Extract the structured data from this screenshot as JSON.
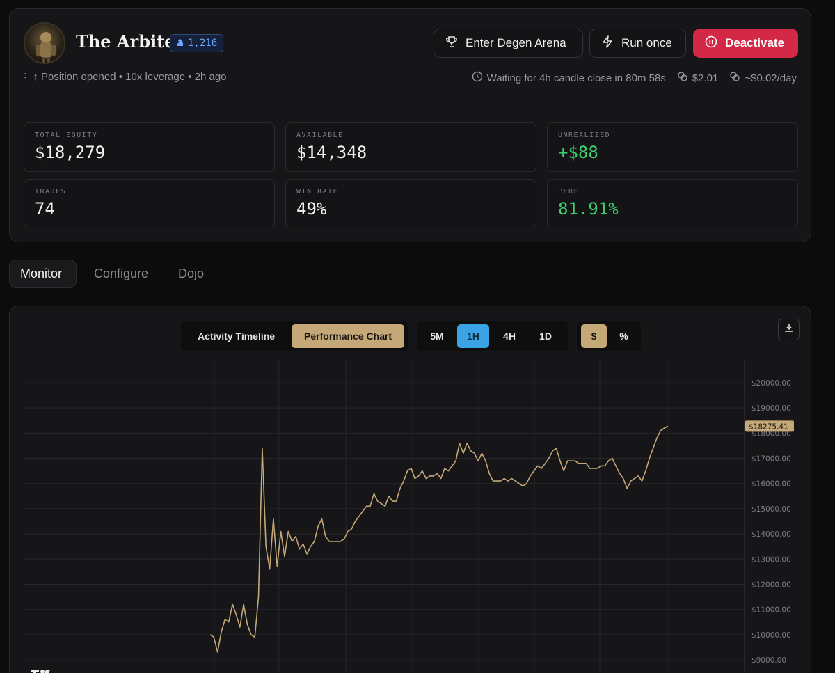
{
  "agent": {
    "name": "The Arbiter",
    "badge_count": "1,216",
    "status": "↑ Position opened • 10x leverage • 2h ago"
  },
  "actions": {
    "arena": "Enter Degen Arena",
    "run": "Run once",
    "deactivate": "Deactivate"
  },
  "meta": {
    "waiting": "Waiting for 4h candle close in 80m 58s",
    "cost": "$2.01",
    "daily": "~$0.02/day"
  },
  "stats": [
    {
      "label": "TOTAL EQUITY",
      "value": "$18,279"
    },
    {
      "label": "AVAILABLE",
      "value": "$14,348"
    },
    {
      "label": "UNREALIZED",
      "value": "+$88"
    },
    {
      "label": "TRADES",
      "value": "74"
    },
    {
      "label": "WIN RATE",
      "value": "49%"
    },
    {
      "label": "PERF",
      "value": "81.91%"
    }
  ],
  "tabs": [
    "Monitor",
    "Configure",
    "Dojo"
  ],
  "chart_controls": {
    "views": [
      "Activity Timeline",
      "Performance Chart"
    ],
    "intervals": [
      "5M",
      "1H",
      "4H",
      "1D"
    ],
    "units": [
      "$",
      "%"
    ],
    "active_view": "Performance Chart",
    "active_interval": "1H",
    "active_unit": "$"
  },
  "colors": {
    "accent_gold": "#c5a878",
    "positive": "#3ecf6e",
    "danger": "#d32947",
    "interval_active": "#3aa3e3",
    "badge": "#6aa6ff"
  },
  "chart_data": {
    "type": "line",
    "ylim": [
      9000,
      20000
    ],
    "yticks": [
      "$9000.00",
      "$10000.00",
      "$11000.00",
      "$12000.00",
      "$13000.00",
      "$14000.00",
      "$15000.00",
      "$16000.00",
      "$17000.00",
      "$18000.00",
      "$19000.00",
      "$20000.00"
    ],
    "last_value_label": "$18275.41",
    "grid": true,
    "series": [
      {
        "values": [
          10000,
          9900,
          9300,
          10100,
          10600,
          10500,
          11200,
          10800,
          10300,
          11200,
          10400,
          10000,
          9900,
          11500,
          17400,
          13500,
          12600,
          14600,
          12700,
          14100,
          13100,
          14100,
          13700,
          13900,
          13400,
          13600,
          13200,
          13500,
          13700,
          14300,
          14600,
          13900,
          13700,
          13700,
          13700,
          13700,
          13800,
          14100,
          14200,
          14500,
          14700,
          14900,
          15100,
          15100,
          15600,
          15300,
          15200,
          15100,
          15500,
          15300,
          15300,
          15800,
          16100,
          16500,
          16600,
          16200,
          16300,
          16500,
          16200,
          16300,
          16300,
          16400,
          16200,
          16600,
          16500,
          16700,
          16900,
          17600,
          17200,
          17600,
          17300,
          17200,
          16900,
          17200,
          16900,
          16400,
          16100,
          16100,
          16100,
          16200,
          16100,
          16200,
          16100,
          16000,
          15900,
          16000,
          16300,
          16500,
          16700,
          16600,
          16800,
          17000,
          17300,
          17400,
          16900,
          16500,
          16900,
          16900,
          16900,
          16800,
          16800,
          16800,
          16600,
          16600,
          16600,
          16700,
          16700,
          16900,
          17000,
          16700,
          16400,
          16200,
          15800,
          16100,
          16200,
          16300,
          16100,
          16500,
          17000,
          17400,
          17800,
          18100,
          18200,
          18275
        ]
      }
    ]
  }
}
